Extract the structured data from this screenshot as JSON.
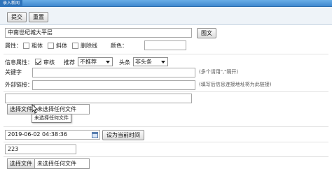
{
  "top_tab": "录入新闻",
  "toolbar": {
    "submit_label": "提交",
    "reset_label": "重置"
  },
  "title_field": {
    "value": "中南世纪城大平层"
  },
  "image_button_label": "图文",
  "attributes": {
    "label": "属性：",
    "bold_label": "粗体",
    "italic_label": "斜体",
    "strike_label": "删除线",
    "color_label": "颜色：",
    "color_value": ""
  },
  "info_attributes": {
    "label": "信息属性：",
    "audit_label": "审核",
    "audit_checked": true,
    "recommend_label": "推荐",
    "recommend_selected": "不推荐",
    "headline_label": "头条",
    "headline_selected": "非头条"
  },
  "keywords": {
    "label": "关键字",
    "value": "",
    "hint": "(多个请用\",\"隔开)"
  },
  "external_link": {
    "label": "外部链接：",
    "value": "",
    "hint": "(填写后信息连接地址将为此链接)"
  },
  "file_upload_1": {
    "button_label": "选择文件",
    "status": "未选择任何文件",
    "tooltip": "未选择任何文件"
  },
  "datetime": {
    "value": "2019-06-02 04:38:36",
    "set_now_label": "设为当前时间"
  },
  "number_field": {
    "value": "223"
  },
  "file_upload_2": {
    "button_label": "选择文件",
    "status": "未选择任何文件"
  }
}
